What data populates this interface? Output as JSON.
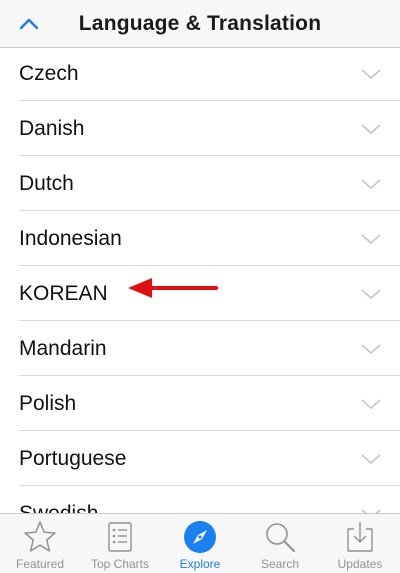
{
  "header": {
    "title": "Language & Translation",
    "back_icon": "chevron-up-icon"
  },
  "list": {
    "items": [
      {
        "label": "Czech"
      },
      {
        "label": "Danish"
      },
      {
        "label": "Dutch"
      },
      {
        "label": "Indonesian"
      },
      {
        "label": "KOREAN"
      },
      {
        "label": "Mandarin"
      },
      {
        "label": "Polish"
      },
      {
        "label": "Portuguese"
      },
      {
        "label": "Swedish"
      }
    ],
    "chevron_icon": "chevron-down-icon"
  },
  "annotation": {
    "icon": "red-arrow-left-icon",
    "color": "#e01010",
    "points_to": "KOREAN"
  },
  "tabbar": {
    "tabs": [
      {
        "label": "Featured",
        "icon": "star-icon",
        "active": false
      },
      {
        "label": "Top Charts",
        "icon": "list-icon",
        "active": false
      },
      {
        "label": "Explore",
        "icon": "compass-icon",
        "active": true
      },
      {
        "label": "Search",
        "icon": "search-icon",
        "active": false
      },
      {
        "label": "Updates",
        "icon": "download-tray-icon",
        "active": false
      }
    ]
  },
  "colors": {
    "accent": "#1a7ff0",
    "inactive": "#929292",
    "divider": "#dcdce0"
  }
}
